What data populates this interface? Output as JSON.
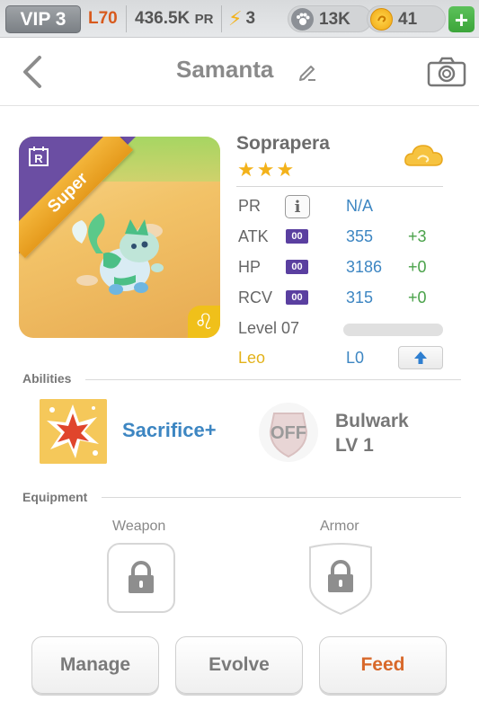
{
  "status_bar": {
    "vip": "VIP 3",
    "level": "L70",
    "power": "436.5K",
    "power_unit": "PR",
    "energy": "3",
    "paws": "13K",
    "coins": "41",
    "plus": "+"
  },
  "header": {
    "title": "Samanta"
  },
  "monster": {
    "rarity": "R",
    "ribbon": "Super",
    "zodiac_symbol": "♌",
    "name": "Soprapera",
    "stars": "★★★",
    "stats": [
      {
        "label": "PR",
        "value": "N/A",
        "bonus": ""
      },
      {
        "label": "ATK",
        "badge": "00",
        "value": "355",
        "bonus": "+3"
      },
      {
        "label": "HP",
        "badge": "00",
        "value": "3186",
        "bonus": "+0"
      },
      {
        "label": "RCV",
        "badge": "00",
        "value": "315",
        "bonus": "+0"
      }
    ],
    "level_label": "Level 07",
    "zodiac_label": "Leo",
    "zodiac_level": "L0"
  },
  "abilities": {
    "section_label": "Abilities",
    "active": "Sacrifice+",
    "passive_off": "OFF",
    "passive_name": "Bulwark",
    "passive_level": "LV 1"
  },
  "equipment": {
    "section_label": "Equipment",
    "weapon_label": "Weapon",
    "armor_label": "Armor"
  },
  "actions": {
    "manage": "Manage",
    "evolve": "Evolve",
    "feed": "Feed"
  },
  "colors": {
    "accent_blue": "#3d86c2",
    "bonus_green": "#4aa24a",
    "feed_orange": "#d8682a",
    "level_orange": "#d85a1d",
    "card_purple": "#6b4ea3",
    "zodiac_gold": "#e3b21a"
  }
}
